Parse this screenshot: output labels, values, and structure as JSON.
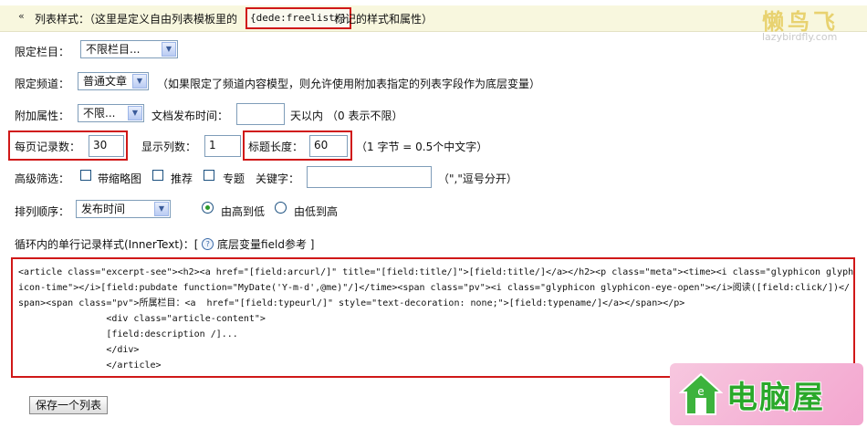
{
  "header": {
    "collapse_glyph": "«",
    "title": "列表样式：（这里是定义自由列表模板里的",
    "tag": "{dede:freelist/}",
    "tail": "标记的样式和属性）"
  },
  "logo_top": {
    "name": "懒鸟飞",
    "url": "lazybirdfly.com"
  },
  "form": {
    "typeid": {
      "label": "限定栏目：",
      "value": "不限栏目..."
    },
    "channel": {
      "label": "限定频道：",
      "value": "普通文章",
      "note": "（如果限定了频道内容模型，则允许使用附加表指定的列表字段作为底层变量）"
    },
    "attr": {
      "label": "附加属性：",
      "value": "不限...",
      "pubdate_label": "文档发布时间：",
      "pubdate_value": "",
      "days_label": "天以内",
      "days_note": "（0 表示不限）"
    },
    "pagesize": {
      "label": "每页记录数：",
      "value": "30"
    },
    "cols": {
      "label": "显示列数：",
      "value": "1"
    },
    "titlelen": {
      "label": "标题长度：",
      "value": "60",
      "note": "（1 字节 = 0.5个中文字）"
    },
    "filter": {
      "label": "高级筛选：",
      "opt_thumb": "带缩略图",
      "opt_recommend": "推荐",
      "opt_special": "专题",
      "keyword_label": "关键字：",
      "keyword_value": "",
      "keyword_note": "（\",\"逗号分开）"
    },
    "order": {
      "label": "排列顺序：",
      "value": "发布时间",
      "desc": "由高到低",
      "asc": "由低到高"
    },
    "innertext": {
      "label": "循环内的单行记录样式(InnerText)：[",
      "help_link": "底层变量field参考",
      "close": "]"
    }
  },
  "innertext_code": "<article class=\"excerpt-see\"><h2><a href=\"[field:arcurl/]\" title=\"[field:title/]\">[field:title/]</a></h2><p class=\"meta\"><time><i class=\"glyphicon glyph\nicon-time\"></i>[field:pubdate function=\"MyDate('Y-m-d',@me)\"/]</time><span class=\"pv\"><i class=\"glyphicon glyphicon-eye-open\"></i>阅读([field:click/])</\nspan><span class=\"pv\">所属栏目：<a  href=\"[field:typeurl/]\" style=\"text-decoration: none;\">[field:typename/]</a></span></p>\n                <div class=\"article-content\">\n                [field:description /]...\n                </div>\n                </article>",
  "save_button": "保存一个列表",
  "watermark": {
    "text": "电脑屋"
  },
  "colors": {
    "accent_red": "#d01818",
    "header_bg": "#f8f7de",
    "watermark_green": "#2aa82a",
    "watermark_pink": "#f3a6cf"
  }
}
